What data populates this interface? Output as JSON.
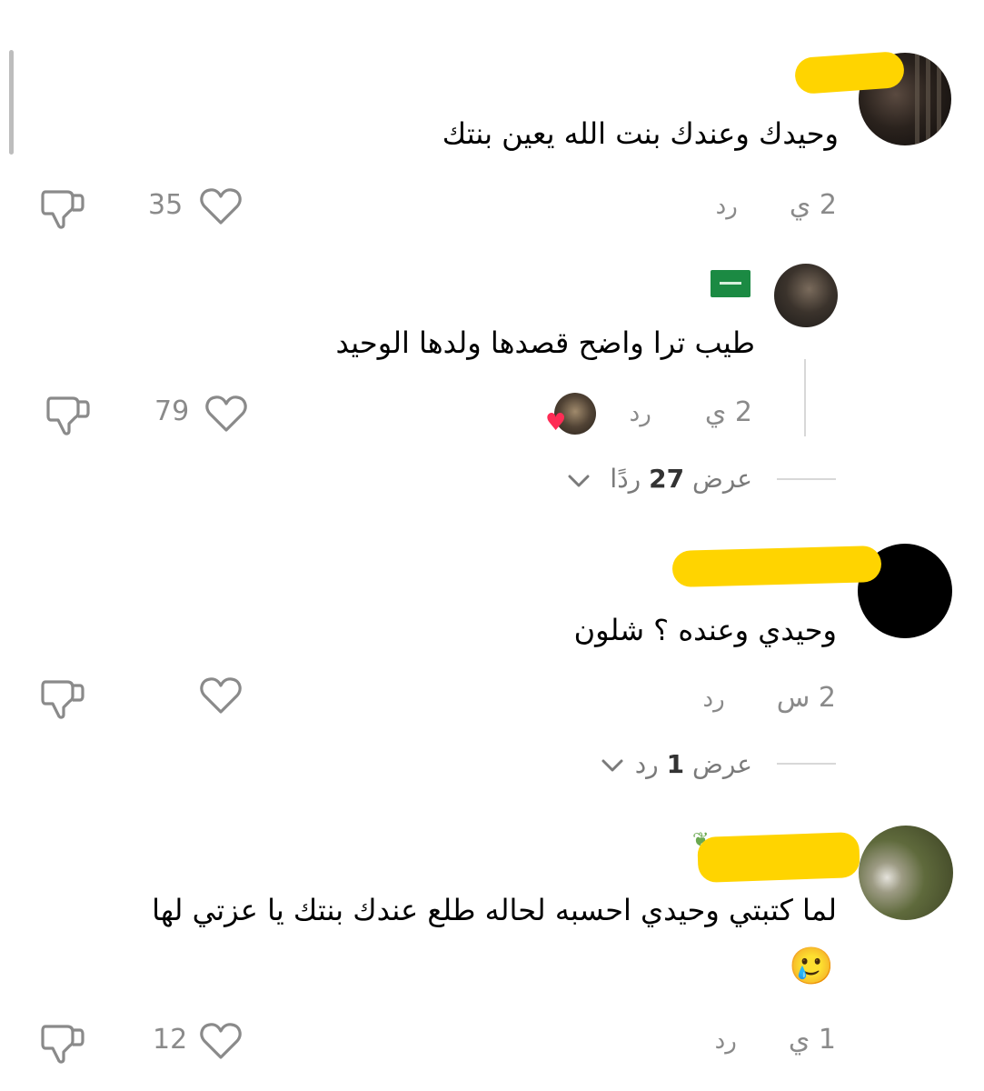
{
  "comments": [
    {
      "text": "وحيدك وعندك بنت الله يعين بنتك",
      "time": "2 ي",
      "reply_label": "رد",
      "likes": "35"
    },
    {
      "text": "طيب ترا واضح قصدها ولدها الوحيد",
      "time": "2 ي",
      "reply_label": "رد",
      "likes": "79",
      "view_replies": {
        "prefix": "عرض",
        "count": "27",
        "suffix": "ردًا"
      }
    },
    {
      "text": "وحيدي وعنده ؟ شلون",
      "time": "2 س",
      "reply_label": "رد",
      "likes": "",
      "view_replies": {
        "prefix": "عرض",
        "count": "1",
        "suffix": "رد"
      }
    },
    {
      "text_line1": "لما كتبتي وحيدي احسبه لحاله طلع عندك بنتك يا عزتي لها",
      "emoji": "🥲",
      "time": "1 ي",
      "reply_label": "رد",
      "likes": "12"
    }
  ],
  "icons": {
    "like": "heart-outline-icon",
    "dislike": "thumbs-down-icon",
    "expand": "chevron-down-icon",
    "creator_liked": "red-heart-icon",
    "flag": "saudi-flag-icon"
  },
  "colors": {
    "highlight": "#ffd400",
    "muted_text": "#8a8a8a",
    "creator_heart": "#fe2c55"
  }
}
